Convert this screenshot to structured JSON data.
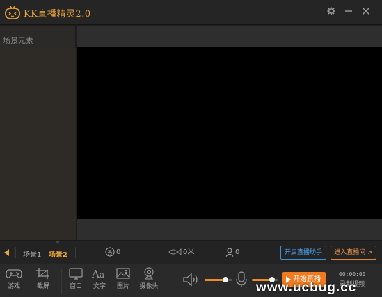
{
  "window": {
    "title": "KK直播精灵2.0",
    "logo_icon": "tv-face-logo-icon",
    "settings_icon": "gear-icon",
    "minimize_icon": "minimize-icon",
    "close_icon": "close-icon"
  },
  "sidebar": {
    "title": "场景元素"
  },
  "scenes": {
    "prev_icon": "triangle-left-icon",
    "tabs": [
      {
        "label": "场景1",
        "active": false
      },
      {
        "label": "场景2",
        "active": true
      }
    ]
  },
  "stats": {
    "gifts": "0",
    "distance": "0米",
    "viewers": "0"
  },
  "actions": {
    "assistant_label": "开启直播助手",
    "enter_room_label": "进入直播间 >"
  },
  "tools": [
    {
      "label": "游戏",
      "icon": "gamepad-icon"
    },
    {
      "label": "截屏",
      "icon": "crop-icon"
    },
    {
      "label": "窗口",
      "icon": "window-icon"
    },
    {
      "label": "文字",
      "icon": "text-icon"
    },
    {
      "label": "图片",
      "icon": "image-icon"
    },
    {
      "label": "摄像头",
      "icon": "webcam-icon"
    }
  ],
  "audio": {
    "speaker_level": 0.75,
    "mic_level": 0.75,
    "speaker_icon": "speaker-icon",
    "mic_icon": "microphone-icon"
  },
  "live": {
    "start_label": "开始直播",
    "timer": "00:00:00",
    "record_label": "录制视频"
  },
  "watermark": "www.ucbug.cc",
  "colors": {
    "accent": "#e8a33a",
    "live_button": "#f07a1e",
    "assistant_border": "#3e8fd8",
    "room_border": "#e0853a"
  }
}
